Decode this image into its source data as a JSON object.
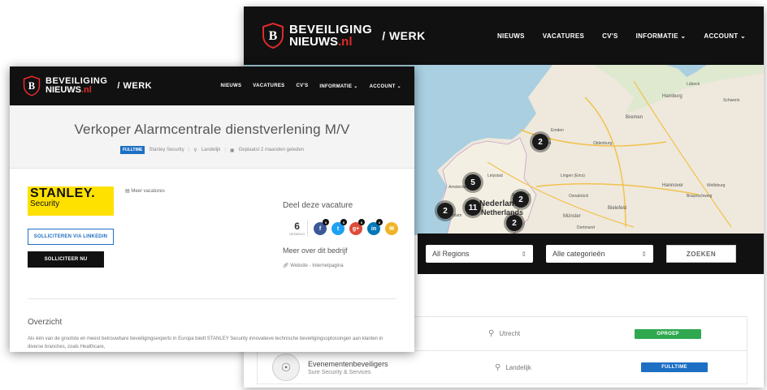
{
  "back_window": {
    "logo": {
      "line1": "BEVEILIGING",
      "line2_main": "NIEUWS",
      "line2_suffix": ".nl",
      "section": "/ WERK"
    },
    "nav": [
      "NIEUWS",
      "VACATURES",
      "CV'S",
      "INFORMATIE ⌄",
      "ACCOUNT ⌄"
    ],
    "map_labels": {
      "country": "Nederland",
      "country2": "Netherlands",
      "cities": [
        "Bremen",
        "Hamburg",
        "Groningen",
        "Amsterdam",
        "Rotterdam",
        "Hannover",
        "Bielefeld",
        "Münster",
        "Osnabrück",
        "Braunschweig",
        "Wolfsburg",
        "Lübeck",
        "Lingen (Ems)",
        "Schwerin",
        "Oldenburg",
        "Emden",
        "Lelystad",
        "Apeldoorn",
        "Dortmund"
      ]
    },
    "clusters": [
      {
        "count": "2"
      },
      {
        "count": "5"
      },
      {
        "count": "2"
      },
      {
        "count": "11"
      },
      {
        "count": "2"
      },
      {
        "count": "2"
      }
    ],
    "filters": {
      "region": "All Regions",
      "category": "Alle categorieën",
      "search_button": "ZOEKEN",
      "arrow": "⇕"
    },
    "jobs": [
      {
        "title": "",
        "company": "",
        "location": "Utrecht",
        "badge": "OPROEP",
        "badge_color": "#2fa84f"
      },
      {
        "title": "Evenementenbeveiligers",
        "company": "Sure Security & Services",
        "location": "Landelijk",
        "badge": "FULLTIME",
        "badge_color": "#1d6fc4"
      }
    ]
  },
  "front_window": {
    "logo": {
      "line1": "BEVEILIGING",
      "line2_main": "NIEUWS",
      "line2_suffix": ".nl",
      "section": "/ WERK"
    },
    "nav": [
      "NIEUWS",
      "VACATURES",
      "CV'S",
      "INFORMATIE ⌄",
      "ACCOUNT ⌄"
    ],
    "job_title": "Verkoper Alarmcentrale dienstverlening M/V",
    "meta": {
      "type": "FULLTIME",
      "company": "Stanley Security",
      "location": "Landelijk",
      "posted": "Geplaatst 2 maanden geleden"
    },
    "company_logo": {
      "line1": "STANLEY.",
      "line2": "Security"
    },
    "meer_vacatures": "Meer vacatures",
    "buttons": {
      "linkedin": "SOLLICITEREN VIA LINKEDIN",
      "apply": "SOLLICITEER NU"
    },
    "share": {
      "heading": "Deel deze vacature",
      "count": "6",
      "count_label": "GEDEELD",
      "networks": [
        {
          "name": "facebook",
          "glyph": "f",
          "color": "#3b5998",
          "count": "0"
        },
        {
          "name": "twitter",
          "glyph": "t",
          "color": "#1da1f2",
          "count": "0"
        },
        {
          "name": "google-plus",
          "glyph": "g+",
          "color": "#dd4b39",
          "count": "0"
        },
        {
          "name": "linkedin",
          "glyph": "in",
          "color": "#0077b5",
          "count": "6"
        },
        {
          "name": "email",
          "glyph": "✉",
          "color": "#f0b429",
          "count": ""
        }
      ]
    },
    "company_more": {
      "heading": "Meer over dit bedrijf",
      "website": "Website - Internetpagina"
    },
    "overview": {
      "title": "Overzicht",
      "text": "Als één van de grootste en meest betrouwbare beveiligingsexperts in Europa biedt STANLEY Security innovatieve technische beveiligingsoplossingen aan klanten in diverse branches, zoals Healthcare,"
    }
  }
}
